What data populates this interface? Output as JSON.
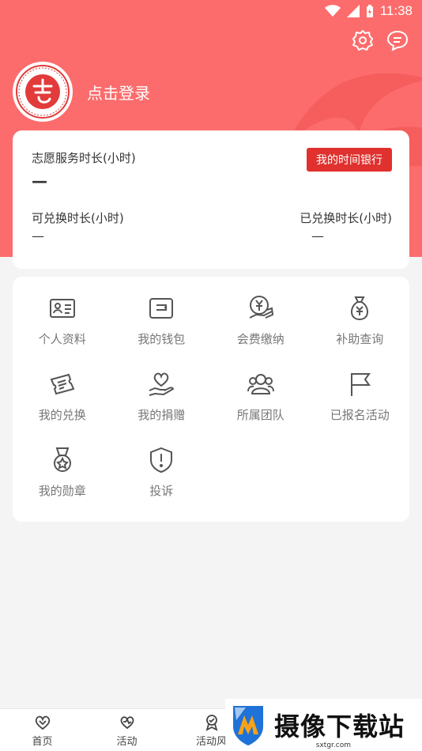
{
  "status_bar": {
    "time": "11:38"
  },
  "profile": {
    "login_text": "点击登录"
  },
  "time_card": {
    "service_hours_label": "志愿服务时长(小时)",
    "service_hours_value": "—",
    "bank_button": "我的时间银行",
    "exchangeable_label": "可兑换时长(小时)",
    "exchangeable_value": "—",
    "exchanged_label": "已兑换时长(小时)",
    "exchanged_value": "—"
  },
  "menu": [
    {
      "label": "个人资料",
      "icon": "id-card-icon"
    },
    {
      "label": "我的钱包",
      "icon": "wallet-icon"
    },
    {
      "label": "会费缴纳",
      "icon": "yuan-pay-icon"
    },
    {
      "label": "补助查询",
      "icon": "money-bag-icon"
    },
    {
      "label": "我的兑换",
      "icon": "ticket-icon"
    },
    {
      "label": "我的捐赠",
      "icon": "donate-heart-icon"
    },
    {
      "label": "所属团队",
      "icon": "team-icon"
    },
    {
      "label": "已报名活动",
      "icon": "flag-icon"
    },
    {
      "label": "我的勋章",
      "icon": "medal-icon"
    },
    {
      "label": "投诉",
      "icon": "shield-alert-icon"
    }
  ],
  "bottom_nav": [
    {
      "label": "首页",
      "icon": "home-heart-icon"
    },
    {
      "label": "活动",
      "icon": "activity-heart-icon"
    },
    {
      "label": "活动风",
      "icon": "award-icon"
    }
  ],
  "watermark": {
    "text": "摄像下载站",
    "url": "sxtgr.com"
  },
  "colors": {
    "header": "#fc6c6c",
    "bank_button": "#e0312e"
  }
}
